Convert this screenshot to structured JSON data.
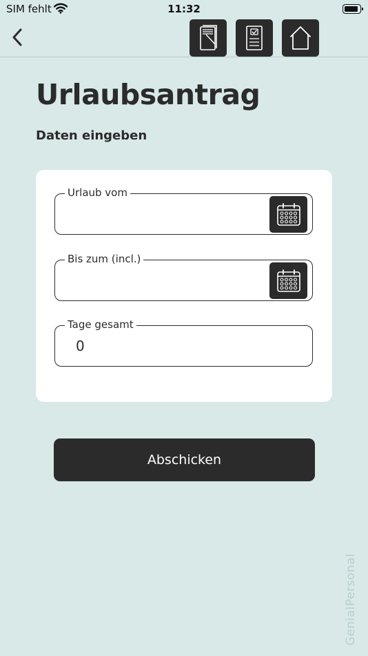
{
  "status_bar": {
    "carrier": "SIM fehlt",
    "time": "11:32"
  },
  "nav": {
    "icons": [
      "back-chevron-icon",
      "documents-icon",
      "checklist-icon",
      "home-icon"
    ]
  },
  "page": {
    "title": "Urlaubsantrag",
    "subtitle": "Daten eingeben"
  },
  "form": {
    "from_label": "Urlaub vom",
    "from_value": "",
    "to_label": "Bis zum (incl.)",
    "to_value": "",
    "days_label": "Tage gesamt",
    "days_value": "0"
  },
  "actions": {
    "submit_label": "Abschicken"
  },
  "branding": {
    "watermark": "GenialPersonal"
  },
  "colors": {
    "background": "#d8e9e8",
    "dark": "#2b2b2b",
    "card": "#ffffff"
  }
}
